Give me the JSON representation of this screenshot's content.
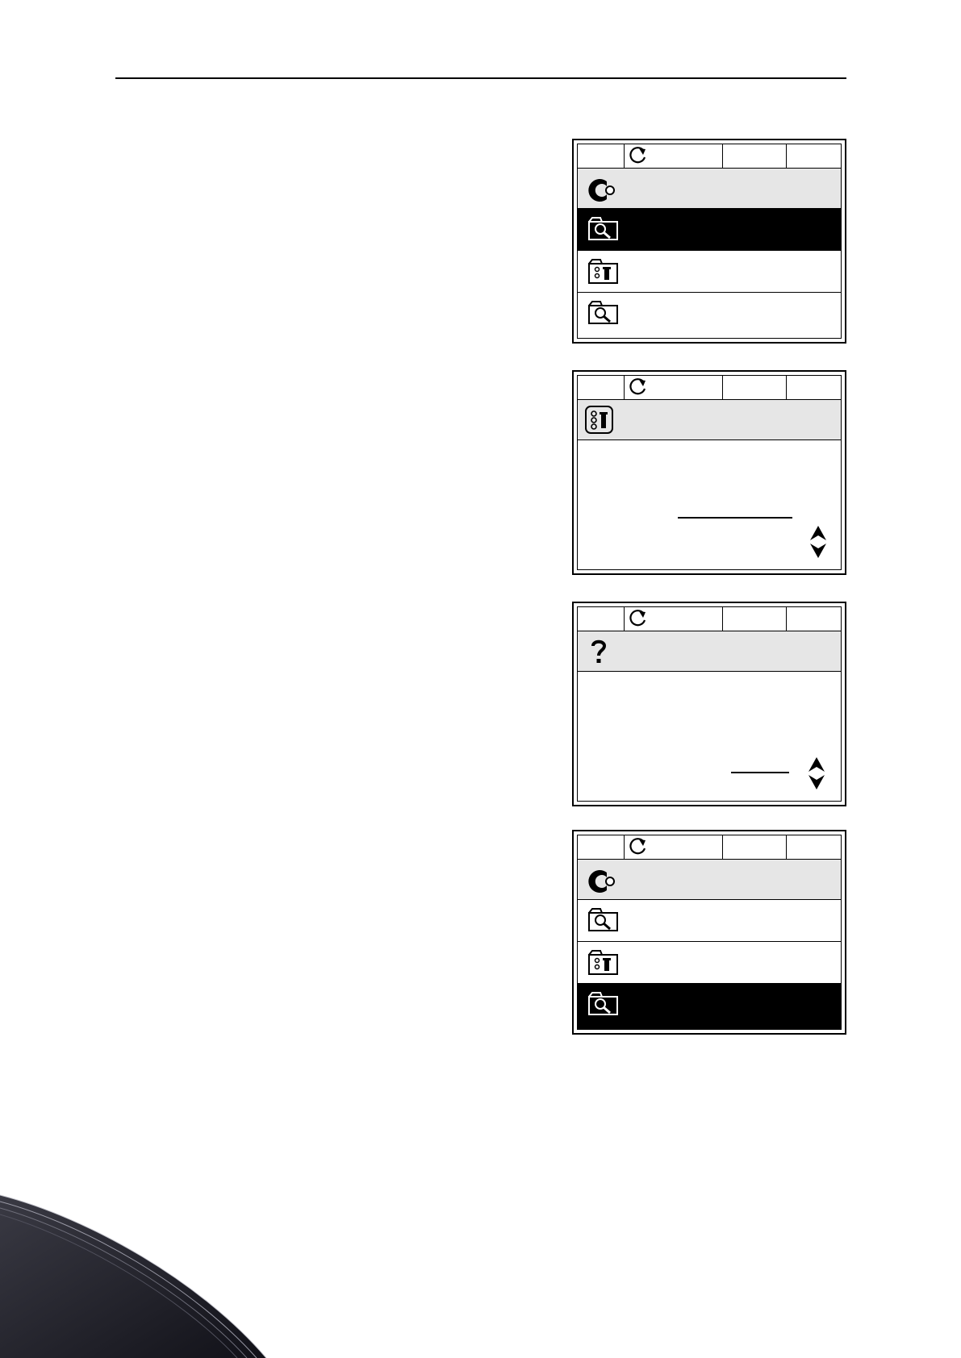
{
  "page": {},
  "screens": [
    {
      "id": "screen-1",
      "kind": "menu",
      "title_icon": "main-menu-icon",
      "rows": [
        {
          "icon": "monitor-folder-icon",
          "selected": true
        },
        {
          "icon": "parameters-folder-icon",
          "selected": false
        },
        {
          "icon": "monitor-folder-icon",
          "selected": false
        }
      ]
    },
    {
      "id": "screen-2",
      "kind": "edit",
      "title_icon": "parameters-folder-icon",
      "controls": [
        "value-field",
        "up-down-arrows"
      ]
    },
    {
      "id": "screen-3",
      "kind": "edit",
      "title_icon": "help-icon",
      "controls": [
        "value-field",
        "up-down-arrows"
      ]
    },
    {
      "id": "screen-4",
      "kind": "menu",
      "title_icon": "main-menu-icon",
      "rows": [
        {
          "icon": "monitor-folder-icon",
          "selected": false
        },
        {
          "icon": "parameters-folder-icon",
          "selected": false
        },
        {
          "icon": "monitor-folder-icon",
          "selected": true
        }
      ]
    }
  ]
}
